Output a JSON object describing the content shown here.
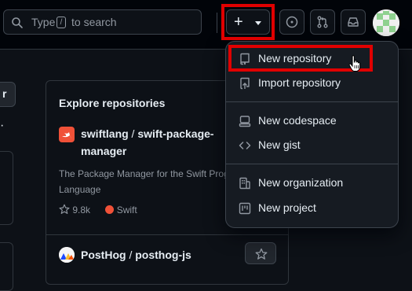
{
  "header": {
    "search": {
      "prefix": "Type",
      "key": "/",
      "suffix": "to search"
    },
    "create_button": {
      "icon": "plus-icon",
      "caret": "triangle-down-icon"
    },
    "icons": [
      "copilot-icon",
      "pull-requests-icon",
      "inbox-icon"
    ]
  },
  "sidebar_fragments": {
    "dots": "·"
  },
  "explore": {
    "heading": "Explore repositories",
    "repos": [
      {
        "owner": "swiftlang",
        "separator": " / ",
        "name": "swift-package-manager",
        "description": "The Package Manager for the Swift Programming Language",
        "stars": "9.8k",
        "language": "Swift",
        "language_color": "#f05138"
      },
      {
        "owner": "PostHog",
        "separator": " / ",
        "name": "posthog-js"
      }
    ]
  },
  "create_menu": {
    "items": [
      {
        "label": "New repository",
        "icon": "repo-icon"
      },
      {
        "label": "Import repository",
        "icon": "repo-push-icon"
      },
      {
        "label": "New codespace",
        "icon": "codespaces-icon"
      },
      {
        "label": "New gist",
        "icon": "code-icon"
      },
      {
        "label": "New organization",
        "icon": "organization-icon"
      },
      {
        "label": "New project",
        "icon": "project-icon"
      }
    ]
  },
  "colors": {
    "highlight": "#e00000",
    "background": "#0d1117",
    "menu_bg": "#161b22"
  }
}
